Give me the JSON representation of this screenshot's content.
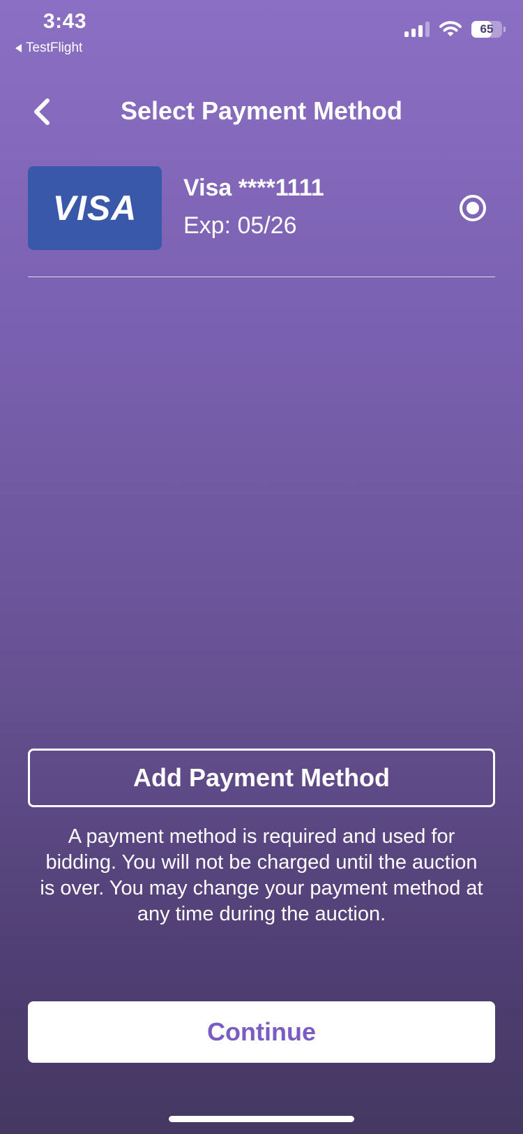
{
  "status_bar": {
    "time": "3:43",
    "back_app": "TestFlight",
    "battery_percent": "65",
    "battery_level": 0.65,
    "signal_bars": 4,
    "signal_active_bars": 3
  },
  "header": {
    "title": "Select Payment Method",
    "back_icon": "chevron-left-icon"
  },
  "payment_methods": [
    {
      "brand_logo_text": "VISA",
      "name": "Visa ****1111",
      "expiry": "Exp: 05/26",
      "selected": true
    }
  ],
  "actions": {
    "add_payment_label": "Add Payment Method",
    "continue_label": "Continue"
  },
  "info": {
    "text": "A payment method is required and used for bidding. You will not be charged until the auction is over. You may change your payment method at any time during the auction."
  },
  "colors": {
    "background_top": "#8b6fc4",
    "background_bottom": "#453862",
    "visa_blue": "#3a58a9",
    "visa_gold": "#e8a21b",
    "continue_text": "#7b5cc4"
  }
}
